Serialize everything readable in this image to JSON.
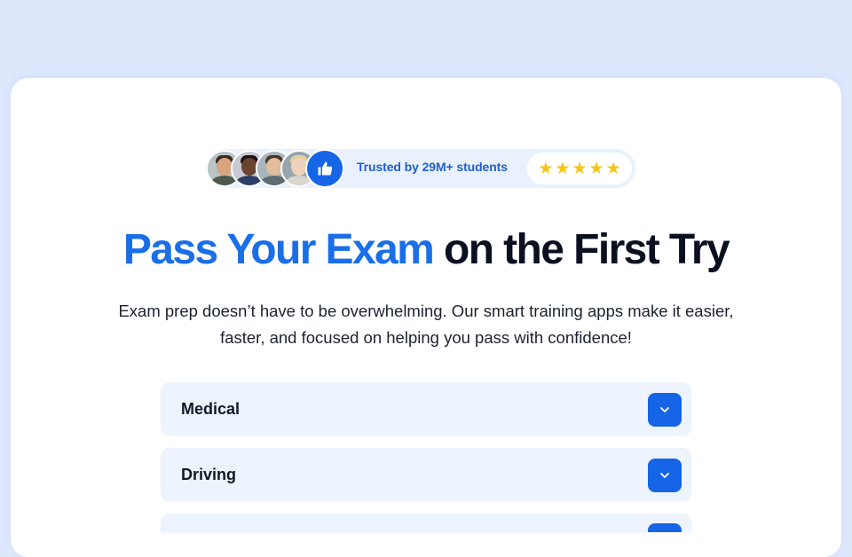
{
  "trust": {
    "text": "Trusted by 29M+ students",
    "rating_stars": 5,
    "avatars": [
      "avatar-1",
      "avatar-2",
      "avatar-3",
      "avatar-4"
    ],
    "badge_icon": "thumbs-up-icon"
  },
  "hero": {
    "headline_accent": "Pass Your Exam",
    "headline_rest": "on the First Try",
    "subtext": "Exam prep doesn’t have to be overwhelming. Our smart training apps make it easier, faster, and focused on helping you pass with confidence!"
  },
  "categories": [
    {
      "label": "Medical",
      "icon": "chevron-down-icon"
    },
    {
      "label": "Driving",
      "icon": "chevron-down-icon"
    },
    {
      "label": "",
      "icon": "chevron-down-icon"
    }
  ],
  "colors": {
    "page_bg": "#dde8fd",
    "accent": "#1a6ee8",
    "button": "#1565e6",
    "star": "#f5c518"
  }
}
